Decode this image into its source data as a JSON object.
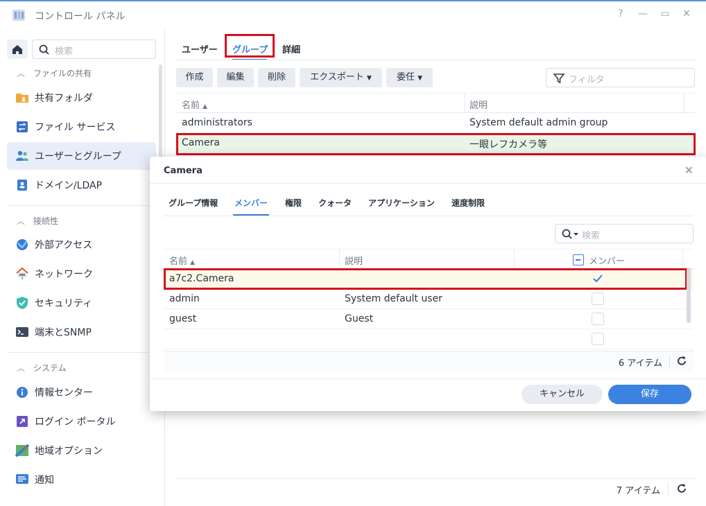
{
  "window": {
    "title": "コントロール パネル",
    "controls": [
      "?",
      "—",
      "▭",
      "✕"
    ]
  },
  "sidebar": {
    "search_placeholder": "検索",
    "sections": [
      {
        "label": "ファイルの共有",
        "items": [
          "共有フォルダ",
          "ファイル サービス",
          "ユーザーとグループ",
          "ドメイン/LDAP"
        ]
      },
      {
        "label": "接続性",
        "items": [
          "外部アクセス",
          "ネットワーク",
          "セキュリティ",
          "端末とSNMP"
        ]
      },
      {
        "label": "システム",
        "items": [
          "情報センター",
          "ログイン ポータル",
          "地域オプション",
          "通知"
        ]
      }
    ],
    "active_item": "ユーザーとグループ"
  },
  "main": {
    "tabs": [
      "ユーザー",
      "グループ",
      "詳細"
    ],
    "selected_tab": "グループ",
    "toolbar": {
      "create": "作成",
      "edit": "編集",
      "delete": "削除",
      "export": "エクスポート",
      "delegate": "委任"
    },
    "filter_placeholder": "フィルタ",
    "columns": {
      "name": "名前",
      "description": "説明"
    },
    "rows": [
      {
        "name": "administrators",
        "description": "System default admin group"
      },
      {
        "name": "Camera",
        "description": "一眼レフカメラ等"
      }
    ],
    "item_count": "7 アイテム"
  },
  "dialog": {
    "title": "Camera",
    "tabs": [
      "グループ情報",
      "メンバー",
      "権限",
      "クォータ",
      "アプリケーション",
      "速度制限"
    ],
    "selected_tab": "メンバー",
    "search_placeholder": "検索",
    "columns": {
      "name": "名前",
      "description": "説明",
      "member": "メンバー"
    },
    "rows": [
      {
        "name": "a7c2.Camera",
        "description": "",
        "member": true
      },
      {
        "name": "admin",
        "description": "System default user",
        "member": false
      },
      {
        "name": "guest",
        "description": "Guest",
        "member": false
      },
      {
        "name": "",
        "description": "",
        "member": false
      }
    ],
    "item_count": "6 アイテム",
    "cancel_label": "キャンセル",
    "save_label": "保存"
  },
  "colors": {
    "accent": "#3a7dd8",
    "highlight_border": "#d40f1f",
    "save_button": "#3c82e0"
  }
}
